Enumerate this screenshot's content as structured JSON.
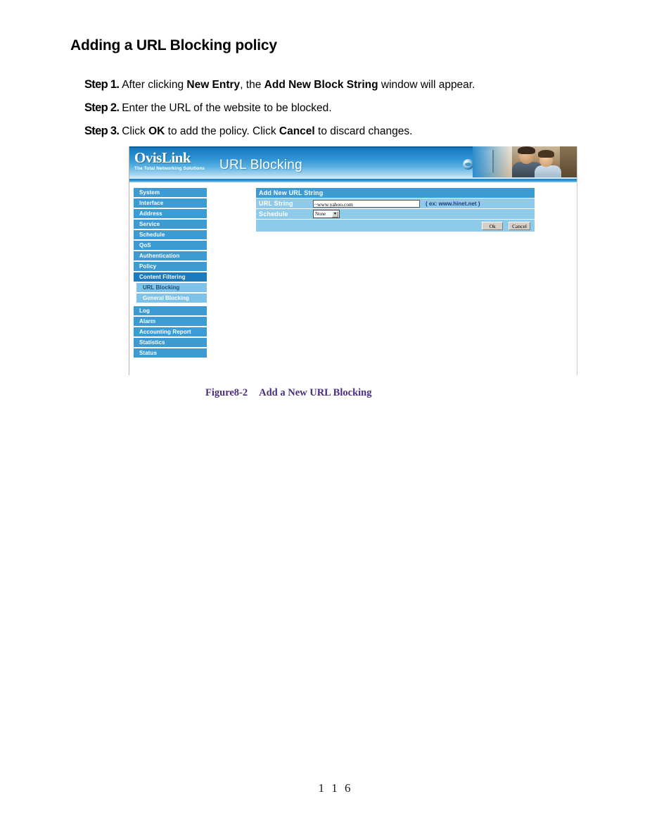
{
  "document": {
    "heading": "Adding a URL Blocking policy",
    "steps": [
      {
        "label": "Step 1.",
        "parts": [
          {
            "t": "After clicking ",
            "b": false
          },
          {
            "t": "New Entry",
            "b": true
          },
          {
            "t": ", the ",
            "b": false
          },
          {
            "t": "Add New Block String",
            "b": true
          },
          {
            "t": " window will appear.",
            "b": false
          }
        ]
      },
      {
        "label": "Step 2.",
        "parts": [
          {
            "t": "Enter the URL of the website to be blocked.",
            "b": false
          }
        ]
      },
      {
        "label": "Step 3.",
        "parts": [
          {
            "t": "Click ",
            "b": false
          },
          {
            "t": "OK",
            "b": true
          },
          {
            "t": " to add the policy.    Click ",
            "b": false
          },
          {
            "t": "Cancel",
            "b": true
          },
          {
            "t": " to discard changes.",
            "b": false
          }
        ]
      }
    ],
    "figure_caption": {
      "number": "Figure8-2",
      "title": "Add a New URL Blocking",
      "color": "#4b2d7f"
    },
    "page_number": "1 1 6"
  },
  "screenshot": {
    "banner": {
      "logo_name": "OvisLink",
      "logo_tagline": "The Total Networking Solutions",
      "title": "URL Blocking",
      "icons": [
        "globe-icon",
        "globe-icon"
      ],
      "colors": {
        "blue_dark": "#1975b8",
        "blue_mid": "#2f93d3",
        "blue_light": "#a9d7f0"
      }
    },
    "sidebar": {
      "items": [
        {
          "label": "System",
          "type": "item",
          "state": "normal"
        },
        {
          "label": "Interface",
          "type": "item",
          "state": "normal"
        },
        {
          "label": "Address",
          "type": "item",
          "state": "normal"
        },
        {
          "label": "Service",
          "type": "item",
          "state": "normal"
        },
        {
          "label": "Schedule",
          "type": "item",
          "state": "normal"
        },
        {
          "label": "QoS",
          "type": "item",
          "state": "normal"
        },
        {
          "label": "Authentication",
          "type": "item",
          "state": "normal"
        },
        {
          "label": "Policy",
          "type": "item",
          "state": "normal"
        },
        {
          "label": "Content Filtering",
          "type": "item",
          "state": "active"
        },
        {
          "label": "URL Blocking",
          "type": "sub",
          "state": "current"
        },
        {
          "label": "General Blocking",
          "type": "sub",
          "state": "normal"
        },
        {
          "label": "Log",
          "type": "item",
          "state": "normal"
        },
        {
          "label": "Alarm",
          "type": "item",
          "state": "normal"
        },
        {
          "label": "Accounting Report",
          "type": "item",
          "state": "normal"
        },
        {
          "label": "Statistics",
          "type": "item",
          "state": "normal"
        },
        {
          "label": "Status",
          "type": "item",
          "state": "normal"
        }
      ],
      "colors": {
        "item_bg": "#3d9bd4",
        "active_bg": "#1d7bbd",
        "sub_bg": "#7ec2e8"
      }
    },
    "form": {
      "panel_title": "Add New URL String",
      "url_string": {
        "label": "URL String",
        "value": "~www.yahoo.com",
        "hint": "( ex: www.hinet.net )"
      },
      "schedule": {
        "label": "Schedule",
        "value": "None"
      },
      "buttons": {
        "ok": "Ok",
        "cancel": "Cancel"
      }
    }
  }
}
